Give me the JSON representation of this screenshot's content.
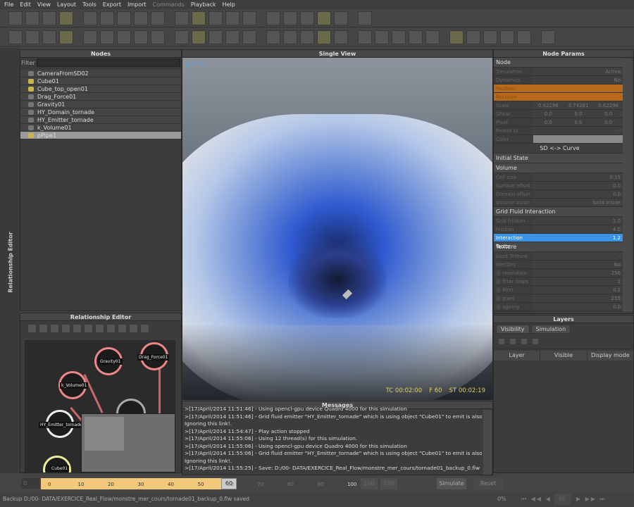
{
  "menu": [
    "File",
    "Edit",
    "View",
    "Layout",
    "Tools",
    "Export",
    "Import",
    "Commands",
    "Playback",
    "Help"
  ],
  "nodes": {
    "title": "Nodes",
    "filter_label": "Filter",
    "filter_value": "",
    "items": [
      {
        "name": "CameraFromSD02",
        "icon": "camera-icon"
      },
      {
        "name": "Cube01",
        "icon": "object-icon"
      },
      {
        "name": "Cube_top_open01",
        "icon": "object-icon"
      },
      {
        "name": "Drag_Force01",
        "icon": "daemon-icon"
      },
      {
        "name": "Gravity01",
        "icon": "daemon-icon"
      },
      {
        "name": "HY_Domain_tornade",
        "icon": "domain-icon"
      },
      {
        "name": "HY_Emitter_tornade",
        "icon": "emitter-icon"
      },
      {
        "name": "k_Volume01",
        "icon": "daemon-icon"
      },
      {
        "name": "pPipe1",
        "icon": "object-icon",
        "selected": true
      }
    ]
  },
  "side_label": "Relationship Editor",
  "viewport": {
    "title": "Single View",
    "camera": "persp",
    "tc": "TC 00:02:00",
    "frame": "F 60",
    "st": "ST 00:02:19"
  },
  "relationship": {
    "title": "Relationship Editor",
    "nodes": [
      "Gravity01",
      "Drag_Force01",
      "k_Volume01",
      "HY_Emitter_tornade",
      "Cube01"
    ]
  },
  "messages": {
    "title": "Messages",
    "lines": [
      ">[17/April/2014 11:51:46] - Using opencl-gpu device Quadro 4000 for this simulation",
      ">[17/April/2014 11:51:46] - Grid fluid emitter \"HY_Emitter_tornade\" which is using object \"Cube01\" to emit is also linked to it.",
      "Ignoring this link!.",
      ">[17/April/2014 11:54:47] - Play action stopped",
      ">[17/April/2014 11:55:06] - Using 12 thread(s) for this simulation.",
      ">[17/April/2014 11:55:06] - Using opencl-gpu device Quadro 4000 for this simulation",
      ">[17/April/2014 11:55:06] - Grid fluid emitter \"HY_Emitter_tornade\" which is using object \"Cube01\" to emit is also linked to it.",
      "Ignoring this link!.",
      ">[17/April/2014 11:55:25] - Save: D:/00- DATA/EXERCICE_Real_Flow/monstre_mer_cours/tornade01_backup_0.flw",
      ">[17/April/2014 11:55:25] - Backup D:/00- DATA/EXERCICE_Real_Flow/monstre_mer_cours/tornade01_backup_0.flw saved"
    ]
  },
  "params": {
    "title": "Node Params",
    "node_section": "Node",
    "node_rows": [
      {
        "label": "Simulation",
        "values": [
          "Active"
        ]
      },
      {
        "label": "Dynamics",
        "values": [
          "No"
        ]
      },
      {
        "label": "Position",
        "values": [
          "",
          "",
          ""
        ],
        "highlight": "orange"
      },
      {
        "label": "Rotation",
        "values": [
          "",
          "",
          ""
        ],
        "highlight": "orange"
      },
      {
        "label": "Scale",
        "values": [
          "0.62296",
          "3.74281",
          "0.62296"
        ]
      },
      {
        "label": "Shear",
        "values": [
          "0.0",
          "0.0",
          "0.0"
        ]
      },
      {
        "label": "Pivot",
        "values": [
          "0.0",
          "0.0",
          "0.0"
        ]
      },
      {
        "label": "Parent to",
        "values": [
          "-"
        ]
      },
      {
        "label": "Color",
        "values": [
          ""
        ]
      }
    ],
    "sd_curve": "SD <-> Curve",
    "initial_state": "Initial State",
    "volume_section": "Volume",
    "volume_rows": [
      {
        "label": "Cell size",
        "values": [
          "0.15"
        ]
      },
      {
        "label": "Surface offset",
        "values": [
          "0.0"
        ]
      },
      {
        "label": "Domain offset",
        "values": [
          "0.0"
        ]
      },
      {
        "label": "Volume mode",
        "values": [
          "Solid inside"
        ]
      }
    ],
    "grid_section": "Grid Fluid Interaction",
    "grid_rows": [
      {
        "label": "Grid friction",
        "values": [
          "1.0"
        ]
      },
      {
        "label": "Friction bandwidth",
        "values": [
          "4.0"
        ]
      },
      {
        "label": "Interaction factor",
        "values": [
          "1.2"
        ],
        "highlight": "selected"
      }
    ],
    "texture_section": "Texture",
    "texture_rows": [
      {
        "label": "Load Texture",
        "values": [
          "-"
        ]
      },
      {
        "label": "Wet/Dry texture",
        "values": [
          "No"
        ]
      },
      {
        "label": "@ resolution",
        "values": [
          "256"
        ]
      },
      {
        "label": "@ filter loops #",
        "values": [
          "1"
        ]
      },
      {
        "label": "@ filter strength",
        "values": [
          "0.1"
        ]
      },
      {
        "label": "@ pixel strength",
        "values": [
          "255"
        ]
      },
      {
        "label": "@ ageing",
        "values": [
          "0.0"
        ]
      }
    ]
  },
  "layers": {
    "title": "Layers",
    "tabs": [
      "Visibility",
      "Simulation"
    ],
    "columns": [
      "Layer",
      "Visible",
      "Display mode"
    ]
  },
  "timeline": {
    "start": "0",
    "ticks": [
      "0",
      "10",
      "20",
      "30",
      "40",
      "50",
      "60",
      "70",
      "80",
      "90",
      "100"
    ],
    "current": "60",
    "end_a": "100",
    "end_b": "100",
    "simulate": "Simulate",
    "reset": "Reset",
    "frame": "60",
    "progress": "0%"
  },
  "status": "Backup D:/00- DATA/EXERCICE_Real_Flow/monstre_mer_cours/tornade01_backup_0.flw saved",
  "colors": {
    "accent": "#3b93e8",
    "orange": "#b86a1c",
    "timeline": "#f2c97a"
  }
}
